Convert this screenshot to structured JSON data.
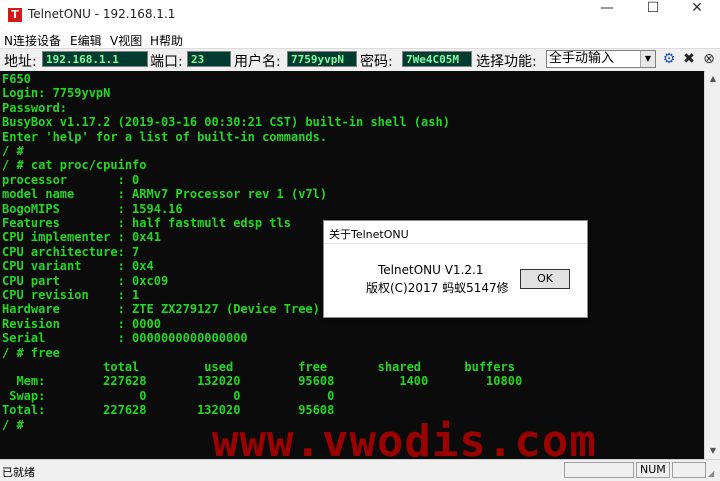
{
  "window": {
    "app_icon": "T",
    "title": "TelnetONU - 192.168.1.1",
    "minimize_icon": "—",
    "maximize_icon": "☐",
    "close_icon": "✕"
  },
  "menu": {
    "items": [
      "N连接设备",
      "E编辑",
      "V视图",
      "H帮助"
    ]
  },
  "toolbar": {
    "address_label": "地址:",
    "address_value": "192.168.1.1",
    "port_label": "端口:",
    "port_value": "23",
    "username_label": "用户名:",
    "username_value": "7759yvpN",
    "password_label": "密码:",
    "password_value": "7We4C05M",
    "function_label": "选择功能:",
    "function_value": "全手动输入",
    "dropdown_icon": "▼",
    "connect_icon": "⚙",
    "disconnect_icon": "✖",
    "help_icon": "⊗",
    "colors": {
      "field_bg": "#003b2f",
      "field_text": "#7dffa0"
    }
  },
  "terminal": {
    "color": "#24d624",
    "lines": [
      "F650",
      "Login: 7759yvpN",
      "Password:",
      "BusyBox v1.17.2 (2019-03-16 00:30:21 CST) built-in shell (ash)",
      "Enter 'help' for a list of built-in commands.",
      "/ #",
      "/ # cat proc/cpuinfo",
      "processor       : 0",
      "model name      : ARMv7 Processor rev 1 (v7l)",
      "BogoMIPS        : 1594.16",
      "Features        : half fastmult edsp tls",
      "CPU implementer : 0x41",
      "CPU architecture: 7",
      "CPU variant     : 0x4",
      "CPU part        : 0xc09",
      "CPU revision    : 1",
      "Hardware        : ZTE ZX279127 (Device Tree)",
      "Revision        : 0000",
      "Serial          : 0000000000000000",
      "/ # free",
      "              total         used         free       shared      buffers",
      "  Mem:        227628       132020        95608         1400        10800",
      " Swap:             0            0            0",
      "Total:        227628       132020        95608",
      "/ #"
    ]
  },
  "watermark": "www.vwodis.com",
  "dialog": {
    "title": "关于TelnetONU",
    "version": "TelnetONU V1.2.1",
    "copyright": "版权(C)2017 蚂蚁5147修",
    "ok_label": "OK"
  },
  "statusbar": {
    "status": "已就绪",
    "num_indicator": "NUM",
    "grip_icon": "◢"
  },
  "scrollbar": {
    "up_icon": "▲",
    "down_icon": "▼"
  }
}
